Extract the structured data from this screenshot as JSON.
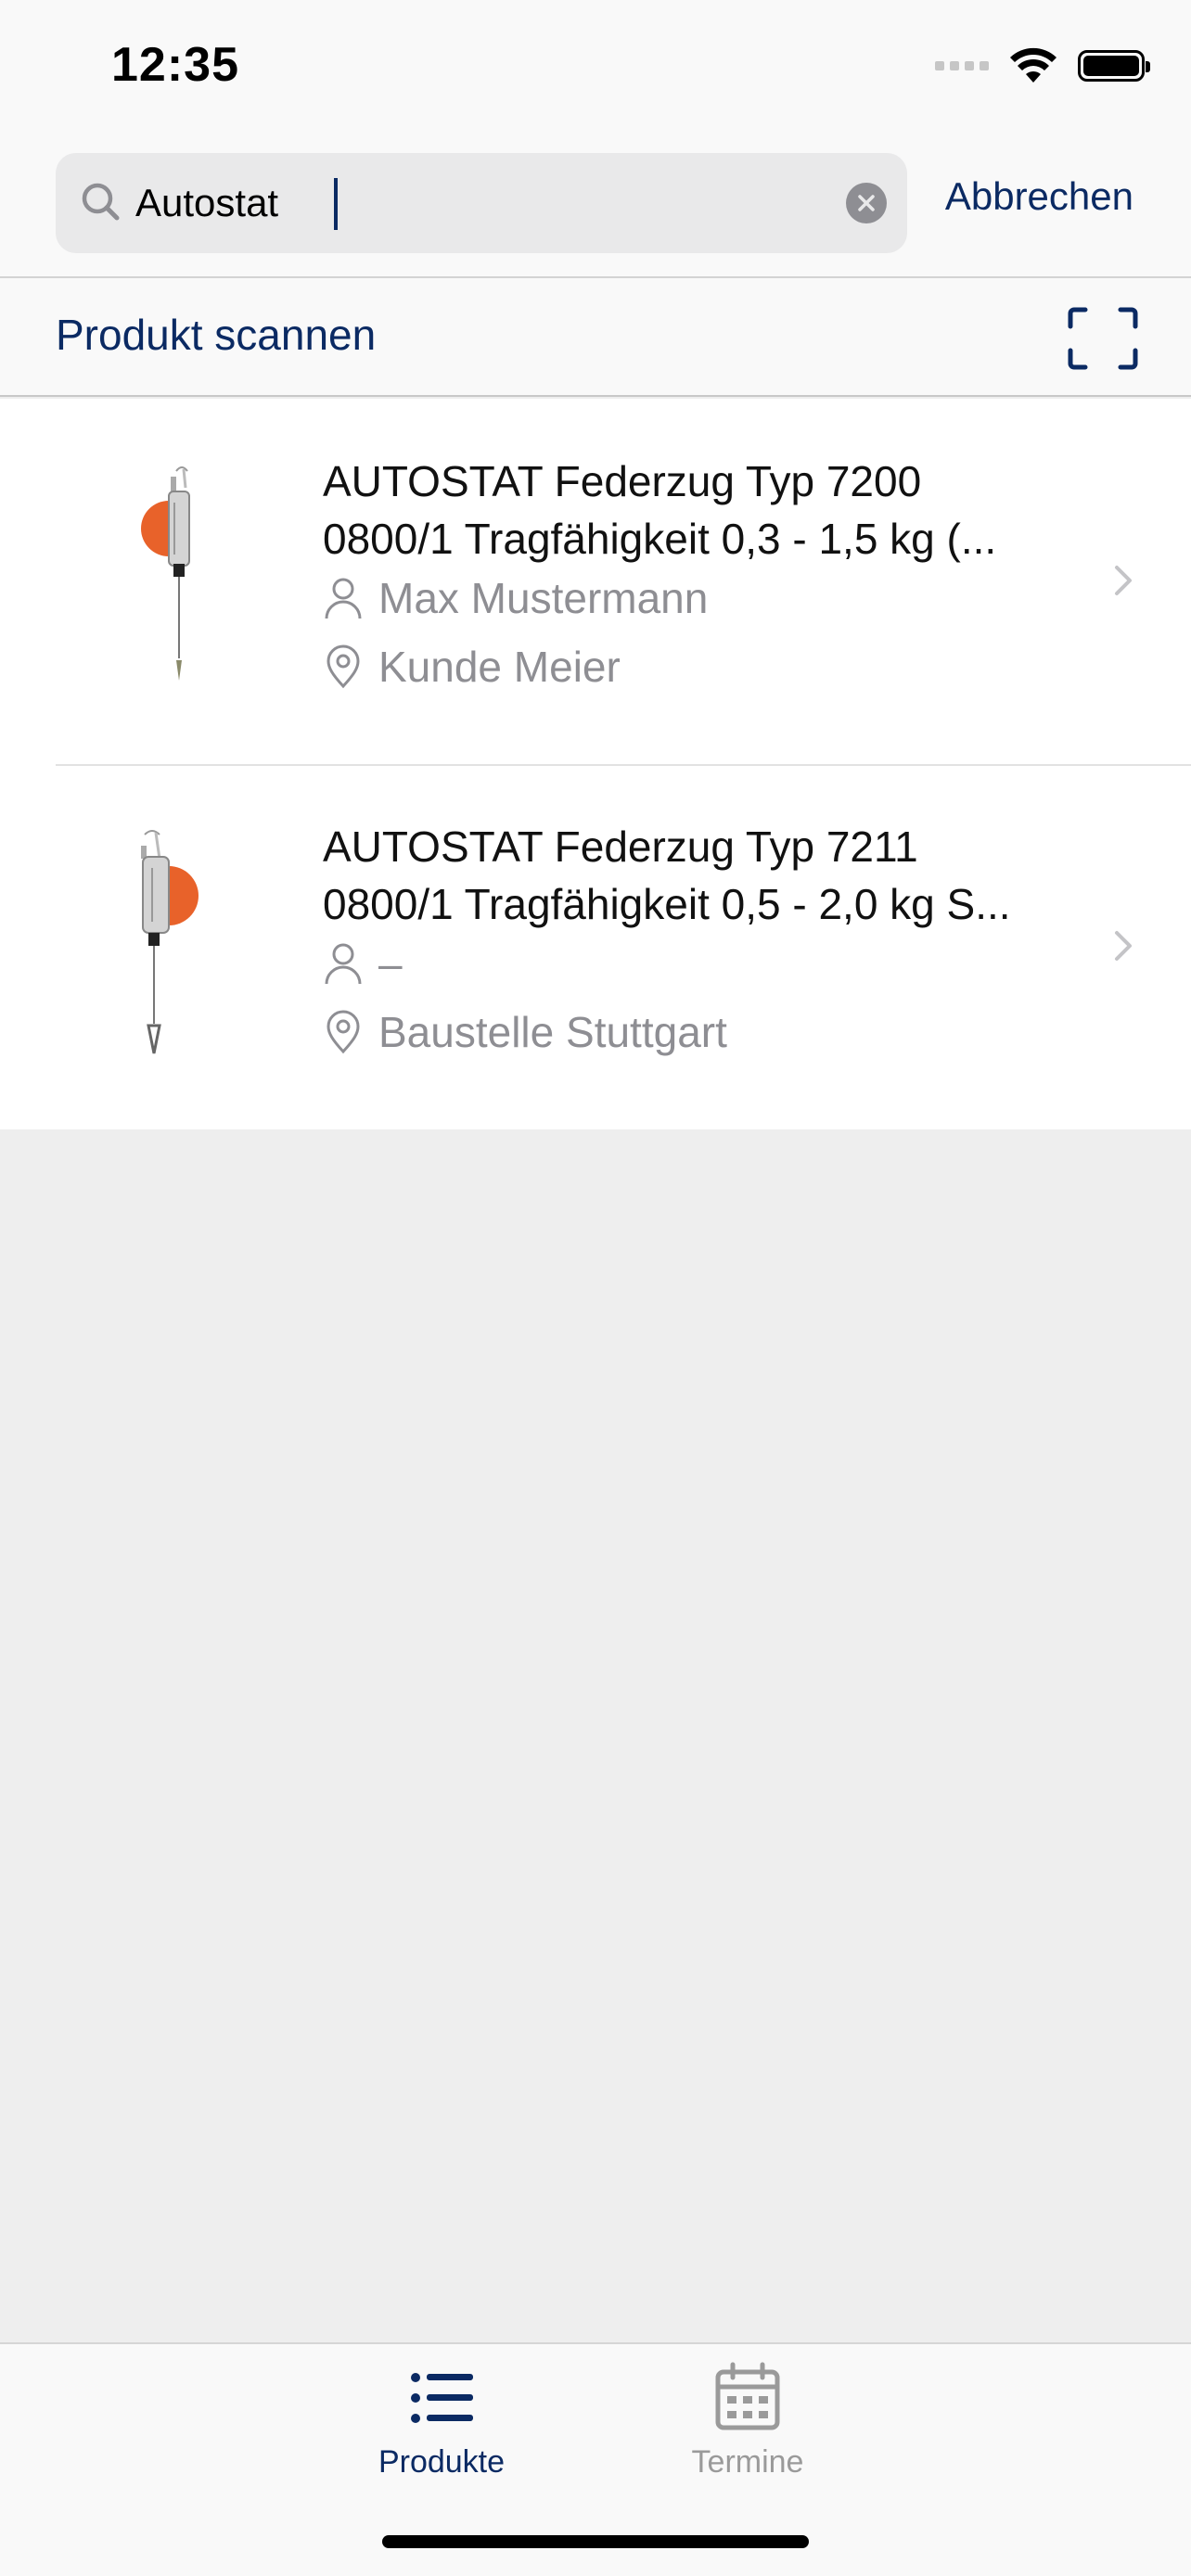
{
  "status_bar": {
    "time": "12:35"
  },
  "search": {
    "value": "Autostat",
    "cancel_label": "Abbrechen"
  },
  "scan": {
    "label": "Produkt scannen"
  },
  "results": [
    {
      "title_line1": "AUTOSTAT Federzug Typ 7200",
      "title_line2": "0800/1 Tragfähigkeit 0,3 - 1,5 kg (...",
      "person": "Max Mustermann",
      "location": "Kunde Meier"
    },
    {
      "title_line1": "AUTOSTAT Federzug Typ 7211",
      "title_line2": "0800/1 Tragfähigkeit 0,5 - 2,0 kg S...",
      "person": "–",
      "location": "Baustelle Stuttgart"
    }
  ],
  "tabbar": {
    "products_label": "Produkte",
    "appointments_label": "Termine",
    "active": "Produkte"
  },
  "colors": {
    "accent": "#0b2a63",
    "product_orange": "#e8622a",
    "inactive": "#9a9a9a"
  }
}
